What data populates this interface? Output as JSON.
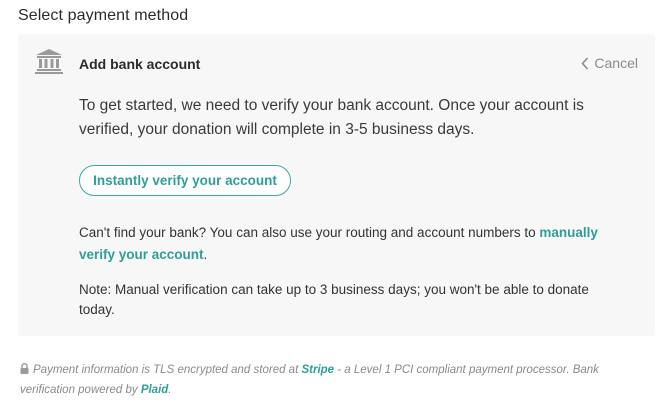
{
  "section_title": "Select payment method",
  "panel": {
    "icon": "bank-icon",
    "title": "Add bank account",
    "cancel_icon": "chevron-left-icon",
    "cancel_label": "Cancel",
    "intro": "To get started, we need to verify your bank account. Once your account is verified, your donation will complete in 3-5 business days.",
    "verify_button": "Instantly verify your account",
    "alt_prefix": "Can't find your bank? You can also use your routing and account numbers to ",
    "alt_link": "manually verify your account",
    "alt_suffix": ".",
    "note": "Note: Manual verification can take up to 3 business days; you won't be able to donate today."
  },
  "footer": {
    "icon": "lock-icon",
    "text_1": "Payment information is TLS encrypted and stored at ",
    "stripe_link": "Stripe",
    "text_2": " - a Level 1 PCI compliant payment processor. Bank verification powered by ",
    "plaid_link": "Plaid",
    "text_3": "."
  },
  "colors": {
    "accent": "#2f9e98",
    "panel_background": "#f7f7f7",
    "muted_text": "#8a8a8a"
  }
}
